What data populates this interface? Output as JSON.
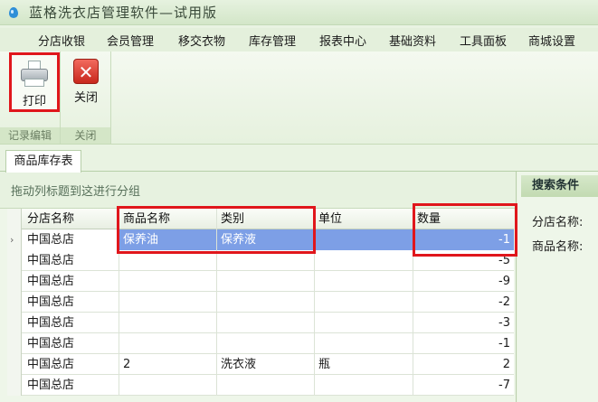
{
  "window": {
    "title": "蓝格洗衣店管理软件—试用版"
  },
  "menu": [
    "分店收银",
    "会员管理",
    "移交衣物",
    "库存管理",
    "报表中心",
    "基础资料",
    "工具面板",
    "商城设置"
  ],
  "ribbon": {
    "print_label": "打印",
    "close_label": "关闭",
    "group1_label": "记录编辑",
    "group2_label": "关闭"
  },
  "tab": {
    "label": "商品库存表"
  },
  "grid": {
    "group_hint": "拖动列标题到这进行分组",
    "columns": [
      "分店名称",
      "商品名称",
      "类别",
      "单位",
      "数量"
    ],
    "rows": [
      {
        "indicator": "›",
        "store": "中国总店",
        "product": "保养油",
        "category": "保养液",
        "unit": "",
        "qty": "-1"
      },
      {
        "indicator": "",
        "store": "中国总店",
        "product": "",
        "category": "",
        "unit": "",
        "qty": "-5"
      },
      {
        "indicator": "",
        "store": "中国总店",
        "product": "",
        "category": "",
        "unit": "",
        "qty": "-9"
      },
      {
        "indicator": "",
        "store": "中国总店",
        "product": "",
        "category": "",
        "unit": "",
        "qty": "-2"
      },
      {
        "indicator": "",
        "store": "中国总店",
        "product": "",
        "category": "",
        "unit": "",
        "qty": "-3"
      },
      {
        "indicator": "",
        "store": "中国总店",
        "product": "",
        "category": "",
        "unit": "",
        "qty": "-1"
      },
      {
        "indicator": "",
        "store": "中国总店",
        "product": "2",
        "category": "洗衣液",
        "unit": "瓶",
        "qty": "2"
      },
      {
        "indicator": "",
        "store": "中国总店",
        "product": "",
        "category": "",
        "unit": "",
        "qty": "-7"
      }
    ]
  },
  "search": {
    "title": "搜索条件",
    "store_label": "分店名称:",
    "product_label": "商品名称:"
  },
  "colors": {
    "selection": "#7d9fe6",
    "highlight_box": "#e0161c",
    "theme": "#e9f3e2"
  }
}
